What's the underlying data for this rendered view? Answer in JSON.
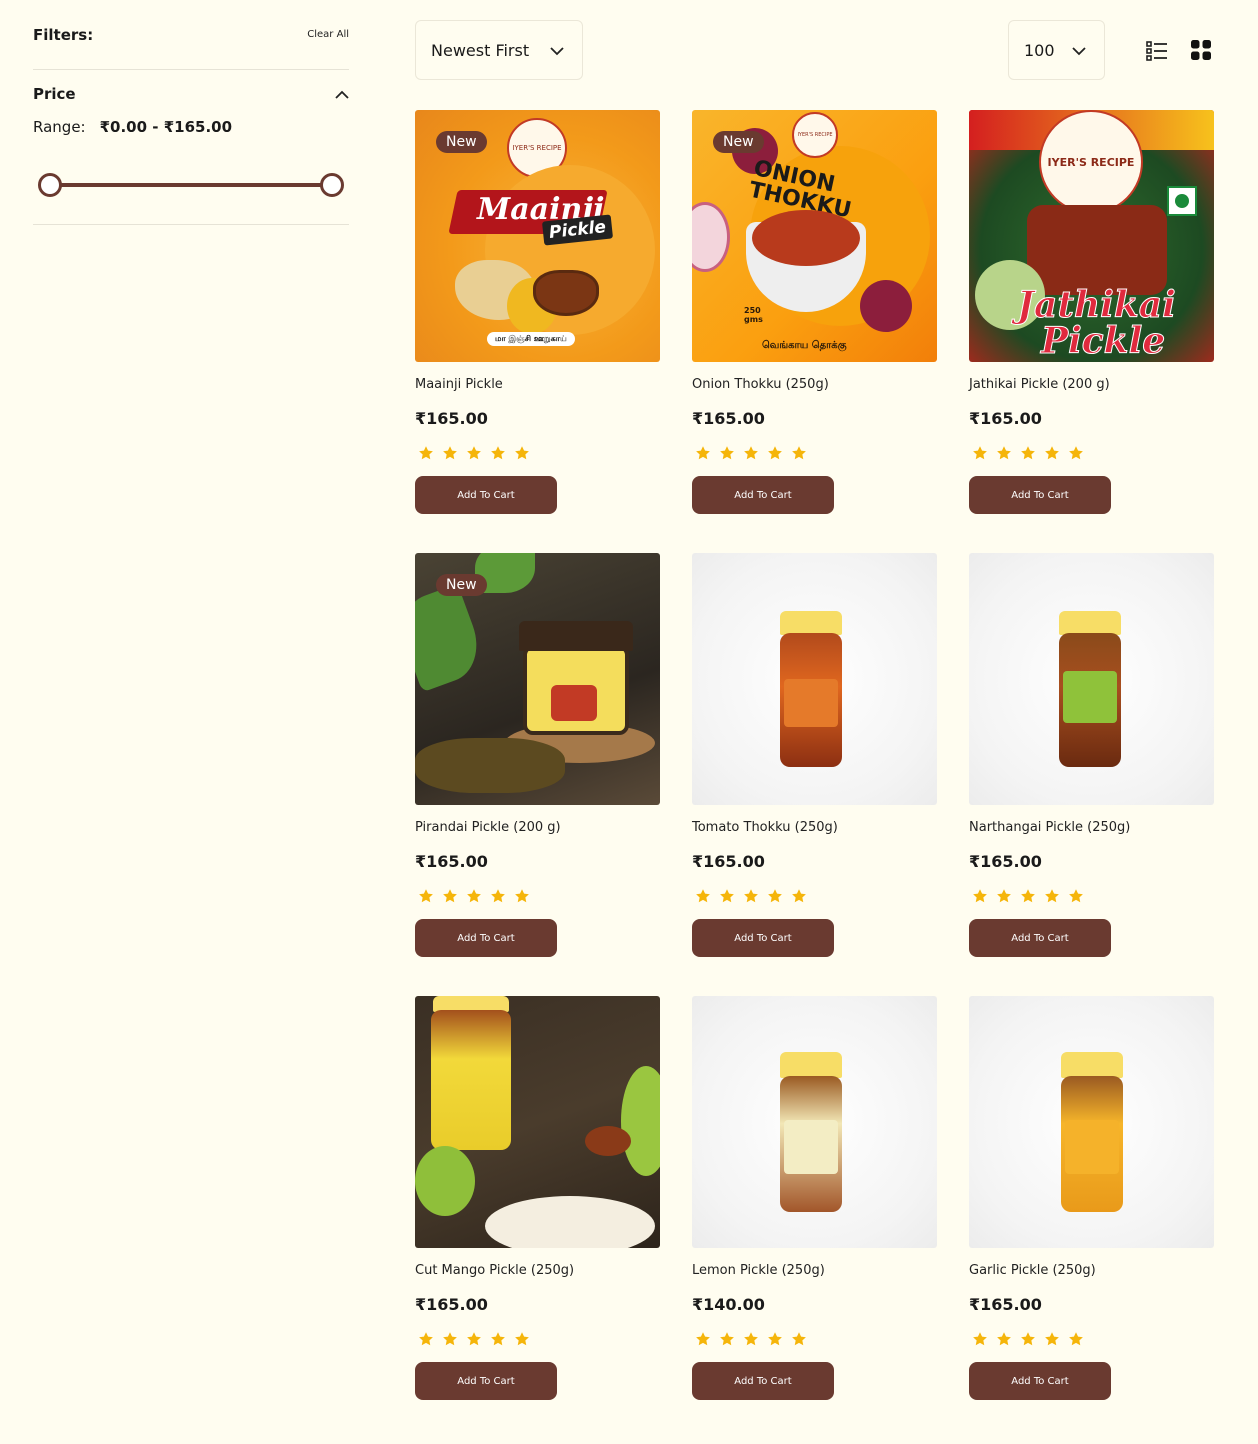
{
  "filters": {
    "title": "Filters:",
    "clear_all": "Clear All",
    "price": {
      "title": "Price",
      "range_label": "Range:",
      "range_value": "₹0.00 - ₹165.00",
      "min": 0,
      "max": 165
    }
  },
  "toolbar": {
    "sort_value": "Newest First",
    "per_page_value": "100",
    "icons": [
      "list-view-icon",
      "grid-view-icon",
      "chevron-down-icon"
    ]
  },
  "colors": {
    "background": "#fffdf0",
    "brand": "#6a3a30",
    "star": "#f5b50a"
  },
  "badge_new": "New",
  "add_to_cart": "Add To Cart",
  "products": [
    {
      "name": "Maainji Pickle",
      "price": "₹165.00",
      "rating": 5,
      "new": true
    },
    {
      "name": "Onion Thokku (250g)",
      "price": "₹165.00",
      "rating": 5,
      "new": true
    },
    {
      "name": "Jathikai Pickle (200 g)",
      "price": "₹165.00",
      "rating": 5,
      "new": false
    },
    {
      "name": "Pirandai Pickle (200 g)",
      "price": "₹165.00",
      "rating": 5,
      "new": true
    },
    {
      "name": "Tomato Thokku (250g)",
      "price": "₹165.00",
      "rating": 5,
      "new": false
    },
    {
      "name": "Narthangai Pickle (250g)",
      "price": "₹165.00",
      "rating": 5,
      "new": false
    },
    {
      "name": "Cut Mango Pickle (250g)",
      "price": "₹165.00",
      "rating": 5,
      "new": false
    },
    {
      "name": "Lemon Pickle (250g)",
      "price": "₹140.00",
      "rating": 5,
      "new": false
    },
    {
      "name": "Garlic Pickle (250g)",
      "price": "₹165.00",
      "rating": 5,
      "new": false
    }
  ],
  "image_text": {
    "maainji_title": "Maainji",
    "maainji_sub": "Pickle",
    "maainji_tamil": "மா இஞ்சி ஊறுகாய்",
    "onion_title": "ONION THOKKU",
    "onion_tamil": "வெங்காய தொக்கு",
    "onion_weight": "250 gms",
    "jathikai_title": "Jathikai",
    "jathikai_sub": "Pickle",
    "logo": "IYER'S RECIPE"
  }
}
